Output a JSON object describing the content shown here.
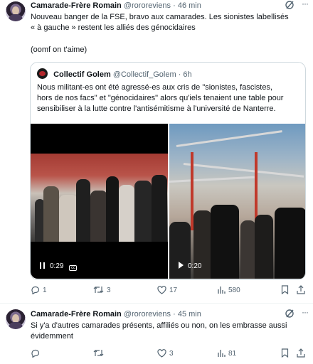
{
  "tweets": [
    {
      "author_name": "Camarade-Frère Romain",
      "author_handle": "@rororeviens",
      "time": "46 min",
      "text_line1": "Nouveau banger de la FSE, bravo aux camarades. Les sionistes labellisés",
      "text_line2": "« à gauche » restent les alliés des génocidaires",
      "text_line3": "(oomf on t'aime)",
      "quote": {
        "author_name": "Collectif Golem",
        "author_handle": "@Collectif_Golem",
        "time": "6h",
        "text_line1": "Nous militant-es ont été agressé-es aux cris de \"sionistes, fascistes,",
        "text_line2": "hors de nos facs\" et \"génocidaires\" alors qu'iels tenaient une table pour",
        "text_line3": "sensibiliser à la lutte contre l'antisémitisme à l'université de Nanterre.",
        "videos": [
          {
            "duration": "0:29",
            "state": "pause",
            "captions": true
          },
          {
            "duration": "0:20",
            "state": "play",
            "captions": false
          }
        ]
      },
      "stats": {
        "replies": "1",
        "reposts": "3",
        "likes": "17",
        "views": "580"
      }
    },
    {
      "author_name": "Camarade-Frère Romain",
      "author_handle": "@rororeviens",
      "time": "45 min",
      "text_line1": "Si y'a d'autres camarades présents, affiliés ou non, on les embrasse aussi",
      "text_line2": "évidemment",
      "stats": {
        "replies": "",
        "reposts": "",
        "likes": "3",
        "views": "81"
      }
    }
  ],
  "colors": {
    "text": "#0f1419",
    "secondary": "#536471",
    "border": "#cfd9de"
  },
  "icons": [
    "grok-icon",
    "more-icon",
    "reply-icon",
    "repost-icon",
    "like-icon",
    "views-icon",
    "bookmark-icon",
    "share-icon",
    "pause-icon",
    "play-icon",
    "captions-icon"
  ]
}
